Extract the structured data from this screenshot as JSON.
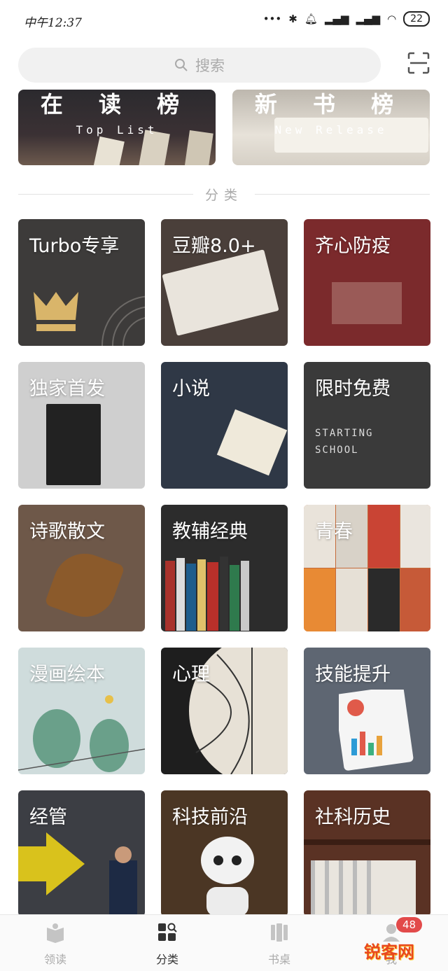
{
  "status_bar": {
    "time": "中午12:37",
    "battery": "22"
  },
  "search": {
    "placeholder": "搜索"
  },
  "rankings": [
    {
      "title": "在 读 榜",
      "subtitle": "Top List"
    },
    {
      "title": "新 书 榜",
      "subtitle": "New Release"
    }
  ],
  "section": {
    "title": "分类"
  },
  "categories": [
    {
      "label": "Turbo专享",
      "color": "#3d3b3a"
    },
    {
      "label": "豆瓣8.0+",
      "color": "#4a3f3a"
    },
    {
      "label": "齐心防疫",
      "color": "#7b2a2c"
    },
    {
      "label": "独家首发",
      "color": "#cfcfcf"
    },
    {
      "label": "小说",
      "color": "#2f3846"
    },
    {
      "label": "限时免费",
      "color": "#3a3a3a"
    },
    {
      "label": "诗歌散文",
      "color": "#6e5849"
    },
    {
      "label": "教辅经典",
      "color": "#2c2c2c"
    },
    {
      "label": "青春",
      "color": "#c46a3a"
    },
    {
      "label": "漫画绘本",
      "color": "#cfdcdc"
    },
    {
      "label": "心理",
      "color": "#1e1e1e"
    },
    {
      "label": "技能提升",
      "color": "#5e6672"
    },
    {
      "label": "经管",
      "color": "#3c3e44"
    },
    {
      "label": "科技前沿",
      "color": "#4b3624"
    },
    {
      "label": "社科历史",
      "color": "#5a3224"
    }
  ],
  "tabs": [
    {
      "label": "领读"
    },
    {
      "label": "分类"
    },
    {
      "label": "书桌"
    },
    {
      "label": "我"
    }
  ],
  "badge": {
    "count": "48"
  },
  "watermark": "锐客网"
}
